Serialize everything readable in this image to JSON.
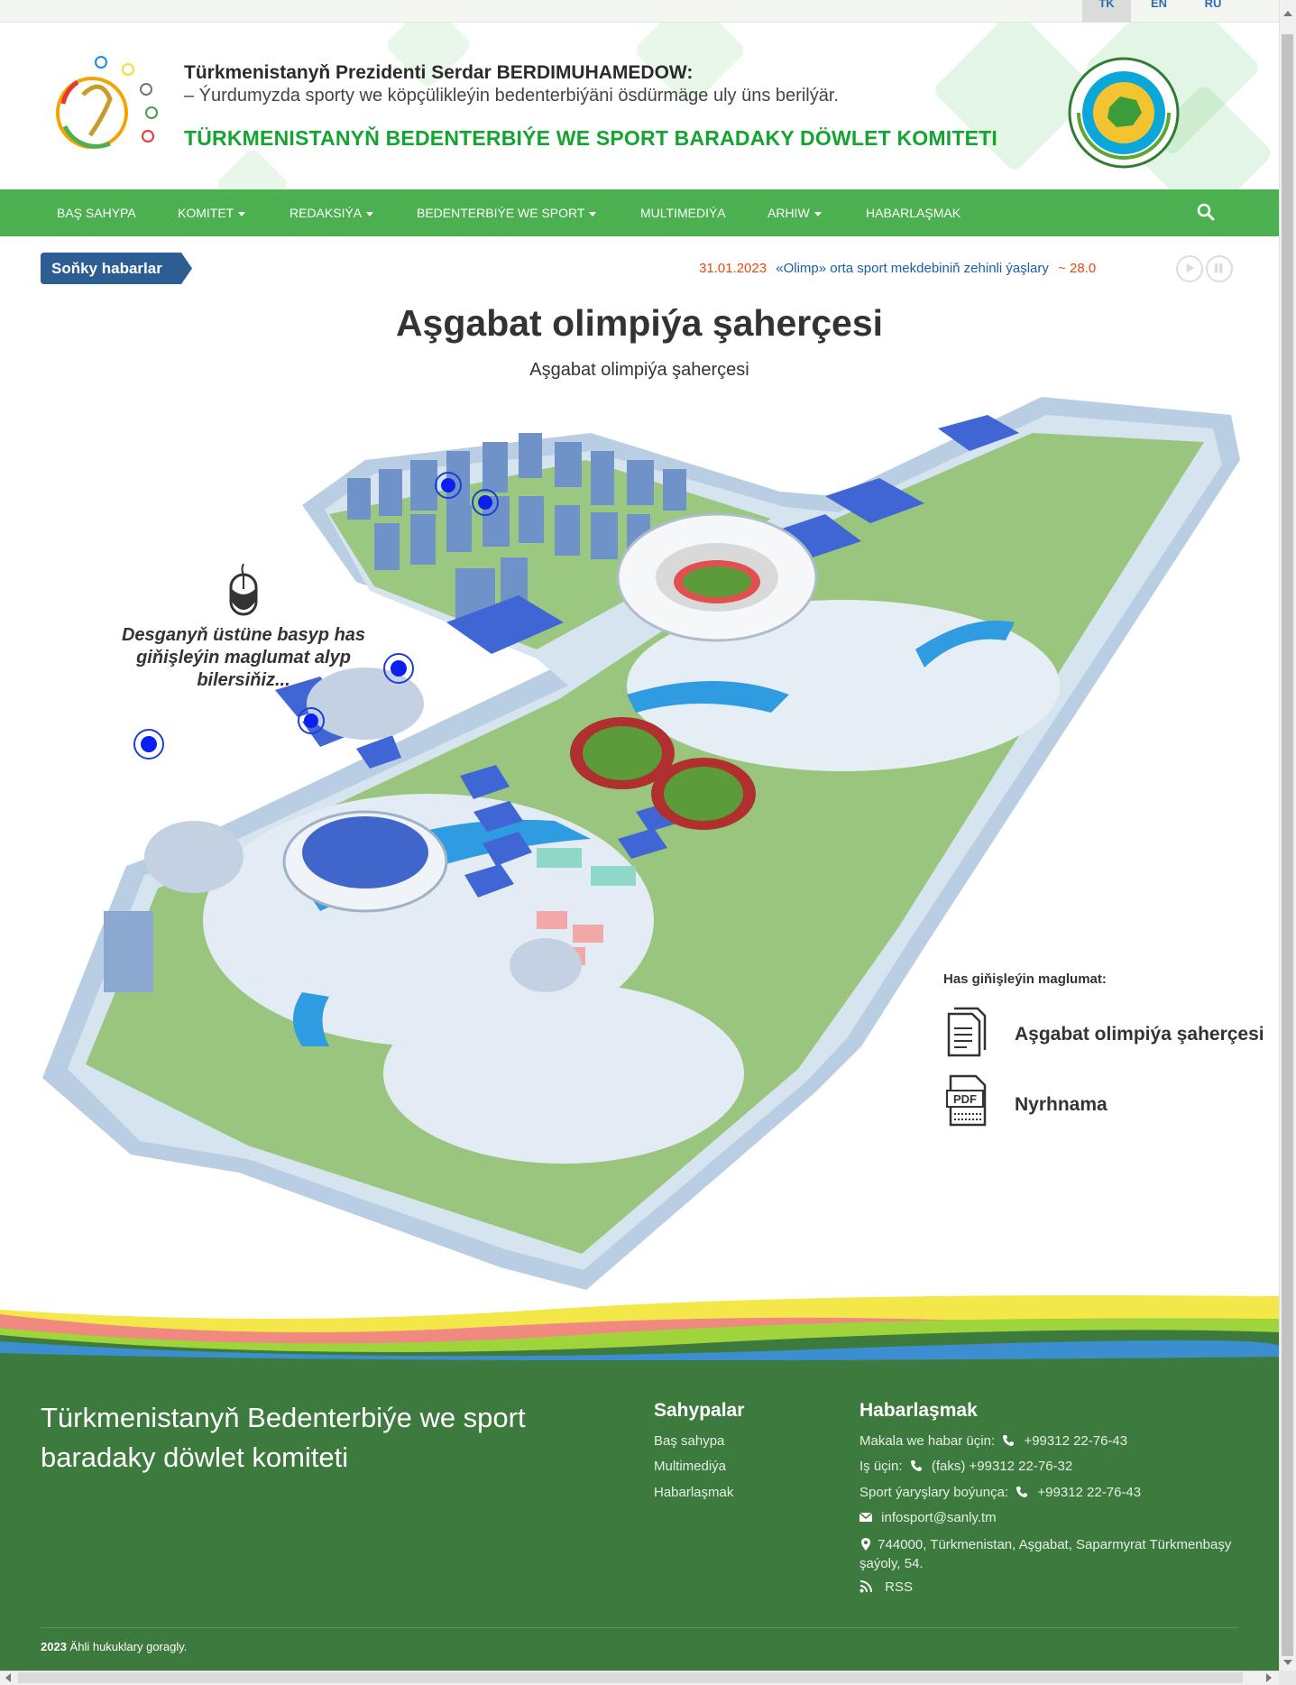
{
  "languages": [
    "TK",
    "EN",
    "RU"
  ],
  "header": {
    "line1": "Türkmenistanyň Prezidenti Serdar BERDIMUHAMEDOW:",
    "line2": "– Ýurdumyzda sporty we köpçülikleýin bedenterbiýäni ösdürmäge uly üns berilýär.",
    "line3": "TÜRKMENISTANYŇ BEDENTERBIÝE WE SPORT BARADAKY DÖWLET KOMITETI"
  },
  "nav": {
    "items": [
      "BAŞ SAHYPA",
      "KOMITET",
      "REDAKSIÝA",
      "BEDENTERBIÝE WE SPORT",
      "MULTIMEDIÝA",
      "ARHIW",
      "HABARLAŞMAK"
    ]
  },
  "news": {
    "label": "Soňky habarlar",
    "date": "31.01.2023",
    "title": "«Olimp» orta sport mekdebiniň zehinli ýaşlary",
    "next": "~ 28.0"
  },
  "main": {
    "title": "Aşgabat olimpiýa şaherçesi",
    "subtitle": "Aşgabat olimpiýa şaherçesi",
    "hint": "Desganyň üstüne basyp has giňişleýin maglumat alyp bilersiňiz...",
    "info_heading": "Has giňişleýin maglumat:",
    "doc_link": "Aşgabat olimpiýa şaherçesi",
    "pdf_label": "PDF",
    "pdf_link": "Nyrhnama"
  },
  "footer": {
    "title": "Türkmenistanyň Bedenterbiýe we sport baradaky döwlet komiteti",
    "pages_heading": "Sahypalar",
    "pages": [
      "Baş sahypa",
      "Multimediýa",
      "Habarlaşmak"
    ],
    "contact_heading": "Habarlaşmak",
    "contact1": "Makala we habar üçin:",
    "phone1": "+99312 22-76-43",
    "contact2": "Iş üçin:",
    "phone2": "(faks) +99312 22-76-32",
    "contact3": "Sport ýaryşlary boýunça:",
    "phone3": "+99312 22-76-43",
    "email": "infosport@sanly.tm",
    "address": "744000, Türkmenistan, Aşgabat, Saparmyrat Türkmenbaşy şaýoly, 54.",
    "rss": "RSS",
    "copy_year": "2023",
    "copy_text": "Ähli hukuklary goragly."
  },
  "colors": {
    "nav_green": "#4caf50",
    "footer_green": "#3d7a3d",
    "header_green_text": "#14a431",
    "news_label_blue": "#2c5e93",
    "ticker_date": "#e64a19",
    "ticker_title": "#1a5ea8"
  }
}
